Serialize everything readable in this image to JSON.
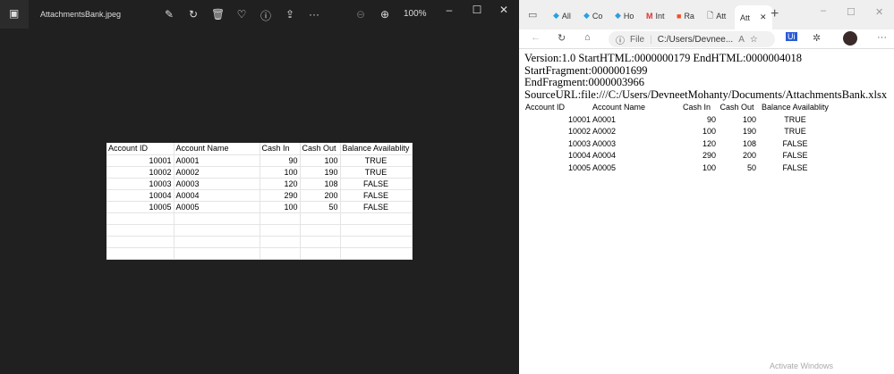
{
  "photos": {
    "filename": "AttachmentsBank.jpeg",
    "zoom": "100%"
  },
  "sheet": {
    "headers": [
      "Account ID",
      "Account Name",
      "Cash In",
      "Cash Out",
      "Balance Availablity"
    ],
    "rows": [
      [
        "10001",
        "A0001",
        "90",
        "100",
        "TRUE"
      ],
      [
        "10002",
        "A0002",
        "100",
        "190",
        "TRUE"
      ],
      [
        "10003",
        "A0003",
        "120",
        "108",
        "FALSE"
      ],
      [
        "10004",
        "A0004",
        "290",
        "200",
        "FALSE"
      ],
      [
        "10005",
        "A0005",
        "100",
        "50",
        "FALSE"
      ]
    ]
  },
  "browser": {
    "tabs": [
      "All",
      "Co",
      "Ho",
      "Int",
      "Ra",
      "Att",
      "Att"
    ],
    "url_prefix": "File",
    "url": "C:/Users/Devnee...",
    "lines": [
      "Version:1.0 StartHTML:0000000179 EndHTML:0000004018 StartFragment:0000001699",
      "EndFragment:0000003966",
      "SourceURL:file:///C:/Users/DevneetMohanty/Documents/AttachmentsBank.xlsx"
    ],
    "watermark": "Activate Windows"
  }
}
